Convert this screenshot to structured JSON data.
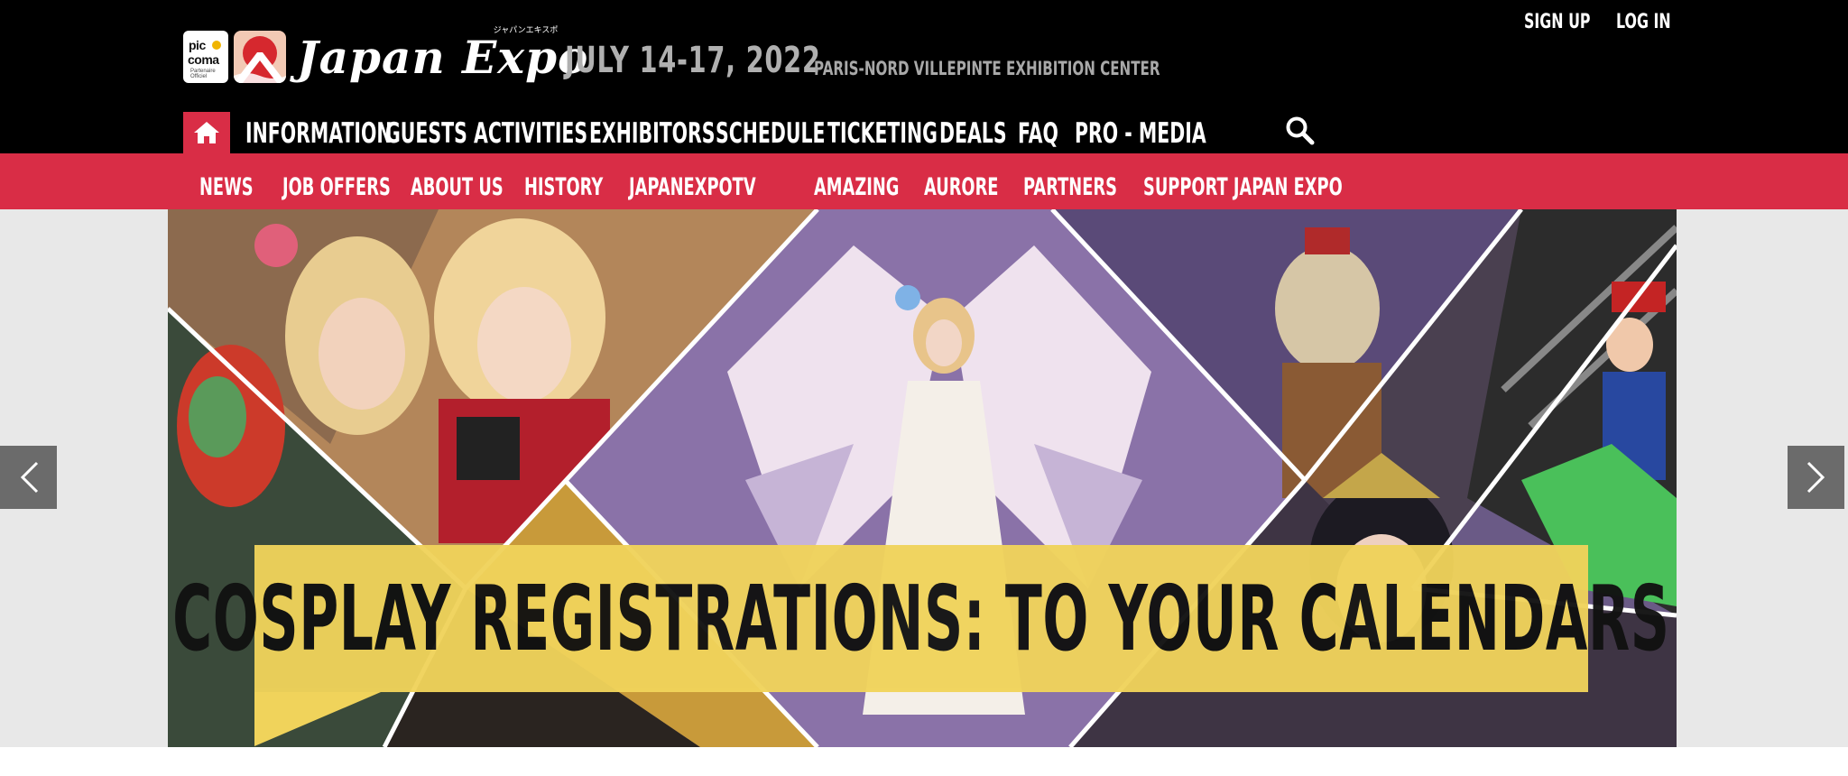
{
  "header": {
    "logo_pico_line1": "pic",
    "logo_pico_line2": "coma",
    "logo_pico_tag": "Partenaire Officiel",
    "brand_name": "Japan Expo",
    "brand_kana": "ジャパンエキスポ",
    "event_date": "JULY 14-17, 2022",
    "event_venue": "PARIS-NORD VILLEPINTE EXHIBITION CENTER",
    "sign_up": "SIGN UP",
    "log_in": "LOG IN"
  },
  "main_nav": {
    "items": [
      {
        "label": "INFORMATION"
      },
      {
        "label": "GUESTS"
      },
      {
        "label": "ACTIVITIES"
      },
      {
        "label": "EXHIBITORS"
      },
      {
        "label": "SCHEDULE"
      },
      {
        "label": "TICKETING"
      },
      {
        "label": "DEALS"
      },
      {
        "label": "FAQ"
      },
      {
        "label": "PRO - MEDIA"
      }
    ]
  },
  "sub_nav": {
    "items": [
      {
        "label": "NEWS"
      },
      {
        "label": "JOB OFFERS"
      },
      {
        "label": "ABOUT US"
      },
      {
        "label": "HISTORY"
      },
      {
        "label": "JAPANEXPOTV"
      },
      {
        "label": "AMAZING"
      },
      {
        "label": "AURORE"
      },
      {
        "label": "PARTNERS"
      },
      {
        "label": "SUPPORT JAPAN EXPO"
      }
    ]
  },
  "banner": {
    "caption": "COSPLAY REGISTRATIONS: TO YOUR CALENDARS"
  },
  "icons": {
    "home": "home-icon",
    "search": "search-icon",
    "prev": "chevron-left-icon",
    "next": "chevron-right-icon"
  },
  "colors": {
    "header_bg": "#000000",
    "accent_red": "#d92d46",
    "caption_yellow": "#f0d35b",
    "muted_text": "#b0b0b0"
  }
}
